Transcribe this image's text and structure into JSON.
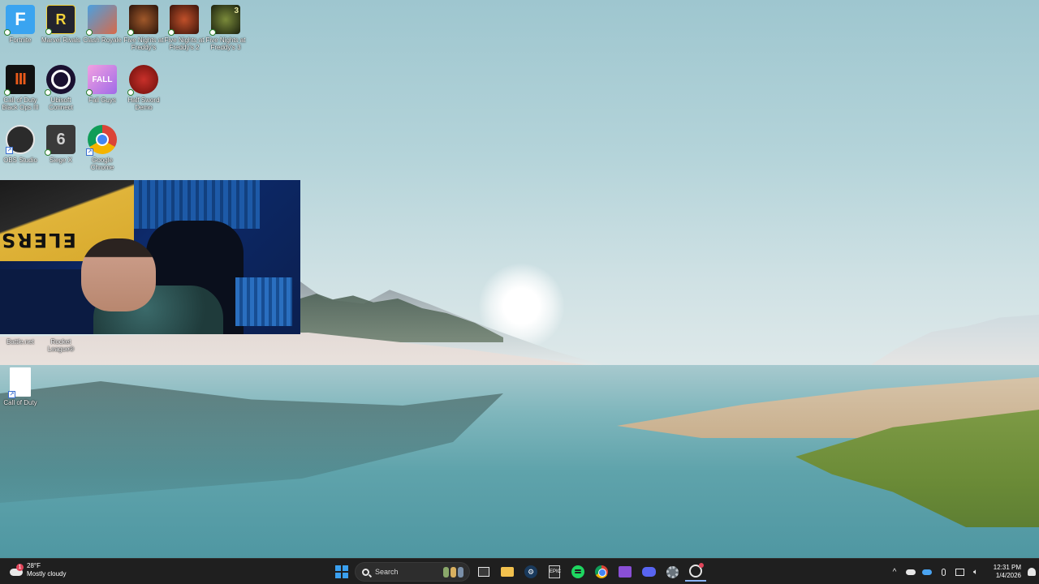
{
  "desktop": {
    "icons": [
      {
        "label": "Fortnite",
        "icon": "fortnite-icon",
        "glyph": "F",
        "color": "#3aa4f0"
      },
      {
        "label": "Marvel Rivals",
        "icon": "marvel-rivals-icon",
        "glyph": "R",
        "color": "#23232e"
      },
      {
        "label": "Clash Royale",
        "icon": "clash-royale-icon",
        "glyph": "",
        "color": "#d86a4a"
      },
      {
        "label": "Five Nights at Freddy's",
        "icon": "fnaf-1-icon",
        "glyph": "",
        "color": "#4a2a1a"
      },
      {
        "label": "Five Nights at Freddy's 2",
        "icon": "fnaf-2-icon",
        "glyph": "",
        "color": "#6a2a1a"
      },
      {
        "label": "Five Nights at Freddy's 3",
        "icon": "fnaf-3-icon",
        "glyph": "3",
        "color": "#2e3a1e"
      },
      {
        "label": "Call of Duty Black Ops III",
        "icon": "cod-bo3-icon",
        "glyph": "III",
        "color": "#e85a1a"
      },
      {
        "label": "Ubisoft Connect",
        "icon": "ubisoft-connect-icon",
        "glyph": "",
        "color": "#1a1030"
      },
      {
        "label": "Fall Guys",
        "icon": "fall-guys-icon",
        "glyph": "FALL",
        "color": "#d08ae8"
      },
      {
        "label": "Half Sword Demo",
        "icon": "half-sword-icon",
        "glyph": "",
        "color": "#9a1a1a"
      },
      {
        "label": "OBS Studio",
        "icon": "obs-studio-icon",
        "glyph": "",
        "color": "#2b2b2b"
      },
      {
        "label": "Siege X",
        "icon": "siege-x-icon",
        "glyph": "6",
        "color": "#3a3a3a"
      },
      {
        "label": "Google Chrome",
        "icon": "google-chrome-icon",
        "glyph": "",
        "color": "#4285f4"
      },
      {
        "label": "Battle.net",
        "icon": "battlenet-icon",
        "glyph": "",
        "color": "#148eff"
      },
      {
        "label": "Rocket League®",
        "icon": "rocket-league-icon",
        "glyph": "",
        "color": "#1a4a8a"
      },
      {
        "label": "Call of Duty",
        "icon": "call-of-duty-icon",
        "glyph": "",
        "color": "#ffffff"
      }
    ]
  },
  "webcam": {
    "flag_text": "ELERS"
  },
  "taskbar": {
    "weather": {
      "temp": "28°F",
      "condition": "Mostly cloudy",
      "alert": "1"
    },
    "search_label": "Search",
    "apps": [
      {
        "name": "task-view",
        "icon": "task-view-icon"
      },
      {
        "name": "file-explorer",
        "icon": "folder-icon"
      },
      {
        "name": "steam",
        "icon": "steam-icon"
      },
      {
        "name": "epic-games",
        "icon": "epic-games-icon",
        "glyph": "EPIC"
      },
      {
        "name": "spotify",
        "icon": "spotify-icon"
      },
      {
        "name": "chrome",
        "icon": "chrome-icon"
      },
      {
        "name": "clipchamp",
        "icon": "clapper-icon"
      },
      {
        "name": "discord",
        "icon": "discord-icon"
      },
      {
        "name": "settings",
        "icon": "gear-icon"
      },
      {
        "name": "obs",
        "icon": "obs-icon"
      }
    ],
    "tray": {
      "chevron": "^"
    },
    "clock": {
      "time": "12:31 PM",
      "date": "1/4/2026"
    }
  }
}
